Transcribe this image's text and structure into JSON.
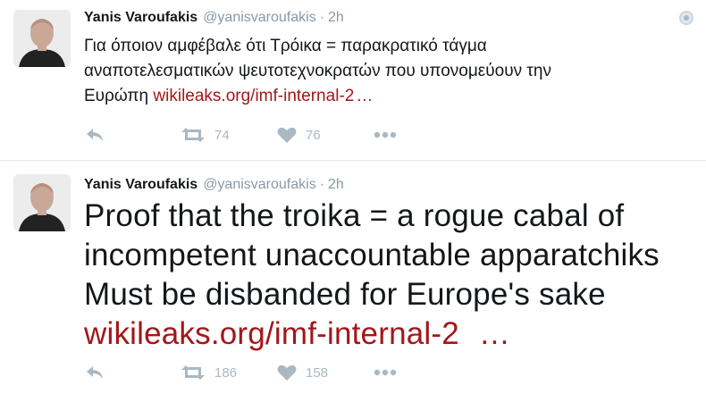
{
  "tweets": [
    {
      "author": "Yanis Varoufakis",
      "handle": "@yanisvaroufakis",
      "separator": "·",
      "time": "2h",
      "text": "Για όποιον αμφέβαλε ότι Τρόικα = παρακρατικό τάγμα αναποτελεσματικών  ψευτοτεχνοκρατών που υπονομεύουν την Ευρώπη ",
      "link": "wikileaks.org/imf-internal-2",
      "ellipsis": "…",
      "retweets": "74",
      "likes": "76"
    },
    {
      "author": "Yanis Varoufakis",
      "handle": "@yanisvaroufakis",
      "separator": "·",
      "time": "2h",
      "text": "Proof that the troika = a rogue cabal of incompetent unaccountable apparatchiks Must be disbanded for Europe's sake ",
      "link": "wikileaks.org/imf-internal-2",
      "ellipsis": "…",
      "retweets": "186",
      "likes": "158"
    }
  ],
  "icons": {
    "reply": "reply-icon",
    "retweet": "retweet-icon",
    "like": "heart-icon",
    "more": "more-icon",
    "caret": "caret-icon"
  },
  "colors": {
    "link": "#a3161a",
    "muted": "#8899a6",
    "icon": "#aab8c2",
    "text": "#14171a"
  }
}
